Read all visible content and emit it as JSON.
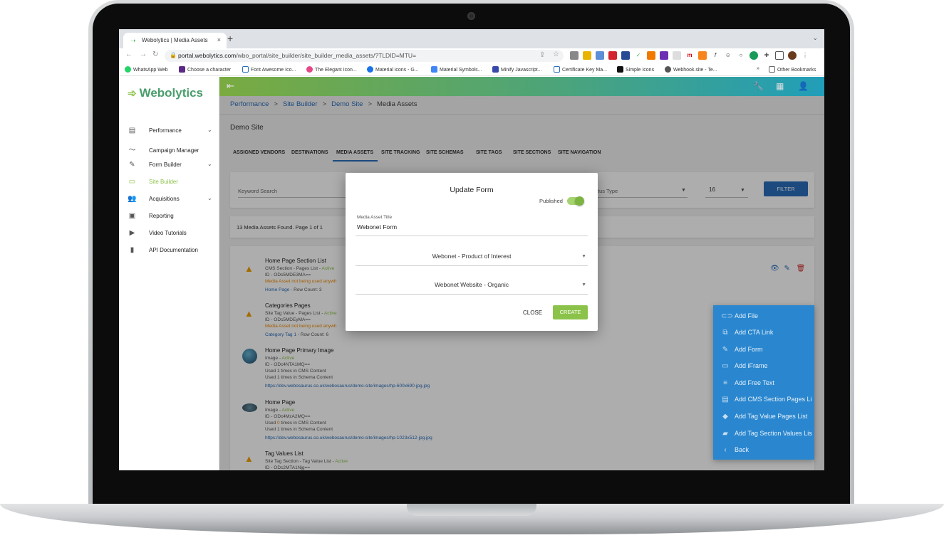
{
  "browser": {
    "tab_title": "Webolytics | Media Assets",
    "tab_close": "×",
    "new_tab": "+",
    "url_domain": "portal.webolytics.com",
    "url_path": "/wbo_portal/site_builder/site_builder_media_assets/?TLDID=MTU=",
    "bookmarks": [
      "WhatsApp Web",
      "Choose a character",
      "Font Awesome Ico...",
      "The Elegant Icon...",
      "Material icons - G...",
      "Material Symbols...",
      "Minify Javascript...",
      "Certificate Key Ma...",
      "Simple Icons",
      "Webhook.site - Te..."
    ],
    "bookmarks_more": "»",
    "other_bookmarks": "Other Bookmarks"
  },
  "sidebar": {
    "logo": "Webolytics",
    "items": [
      {
        "label": "Performance",
        "icon": "dashboard-icon",
        "chevron": true
      },
      {
        "label": "Campaign Manager",
        "icon": "trend-icon",
        "chevron": false
      },
      {
        "label": "Form Builder",
        "icon": "form-icon",
        "chevron": true
      },
      {
        "label": "Site Builder",
        "icon": "web-icon",
        "chevron": false,
        "active": true
      },
      {
        "label": "Acquisitions",
        "icon": "people-icon",
        "chevron": true
      },
      {
        "label": "Reporting",
        "icon": "report-icon",
        "chevron": false
      },
      {
        "label": "Video Tutorials",
        "icon": "video-icon",
        "chevron": false
      },
      {
        "label": "API Documentation",
        "icon": "book-icon",
        "chevron": false
      }
    ]
  },
  "breadcrumb": {
    "items": [
      "Performance",
      "Site Builder",
      "Demo Site"
    ],
    "current": "Media Assets"
  },
  "page_title": "Demo Site",
  "tabs": [
    "ASSIGNED VENDORS",
    "DESTINATIONS",
    "MEDIA ASSETS",
    "SITE TRACKING",
    "SITE SCHEMAS",
    "SITE TAGS",
    "SITE SECTIONS",
    "SITE NAVIGATION"
  ],
  "active_tab": "MEDIA ASSETS",
  "filters": {
    "keyword_placeholder": "Keyword Search",
    "status_label": "tus Type",
    "page_size": "16",
    "filter_button": "FILTER"
  },
  "count_text": "13 Media Assets Found. Page 1 of 1",
  "assets": [
    {
      "title": "Home Page Section List",
      "type": "CMS Section - Pages List",
      "status": "Active",
      "id": "ID - ODc5MDE3MA==",
      "warning": "Media Asset not being used anywh",
      "link": "Home Page",
      "rows": "Row Count: 3"
    },
    {
      "title": "Categories Pages",
      "type": "Site Tag Value - Pages List",
      "status": "Active",
      "id": "ID - ODc5MDEyMA==",
      "warning": "Media Asset not being used anywh",
      "link": "Category Tag 1",
      "rows": "Row Count: 6"
    },
    {
      "title": "Home Page Primary Image",
      "type": "Image",
      "status": "Active",
      "id": "ID - ODc4NTA1MQ==",
      "used_cms": "Used 1 times in CMS Content",
      "used_schema": "Used 1 times in Schema Content",
      "url": "https://dev.webosaurus.co.uk/webosaurus/demo-site/images/hp-600x690-jpg.jpg"
    },
    {
      "title": "Home Page",
      "type": "Image",
      "status": "Active",
      "id": "ID - ODc4MzA2MQ==",
      "used_cms_pre": "Used ",
      "used_cms_n": "0",
      "used_cms_post": " times in CMS Content",
      "used_schema": "Used 1 times in Schema Content",
      "url": "https://dev.webosaurus.co.uk/webosaurus/demo-site/images/hp-1023x512-jpg.jpg"
    },
    {
      "title": "Tag Values List",
      "type": "Site Tag Section - Tag Value List",
      "status": "Active",
      "id": "ID - ODc2MTA1Njg=="
    }
  ],
  "modal": {
    "title": "Update Form",
    "published_label": "Published",
    "published": true,
    "field_label": "Media Asset Title",
    "field_value": "Webonet Form",
    "select1": "Webonet - Product of Interest",
    "select2": "Webonet Website - Organic",
    "close": "CLOSE",
    "create": "CREATE"
  },
  "add_menu": [
    {
      "label": "Add File",
      "icon": "link-icon"
    },
    {
      "label": "Add CTA Link",
      "icon": "external-link-icon"
    },
    {
      "label": "Add Form",
      "icon": "form-icon"
    },
    {
      "label": "Add iFrame",
      "icon": "iframe-icon"
    },
    {
      "label": "Add Free Text",
      "icon": "text-icon"
    },
    {
      "label": "Add CMS Section Pages Li",
      "icon": "list-icon"
    },
    {
      "label": "Add Tag Value Pages List",
      "icon": "tag-icon"
    },
    {
      "label": "Add Tag Section Values Lis",
      "icon": "label-icon"
    },
    {
      "label": "Back",
      "icon": "chevron-left-icon"
    }
  ]
}
